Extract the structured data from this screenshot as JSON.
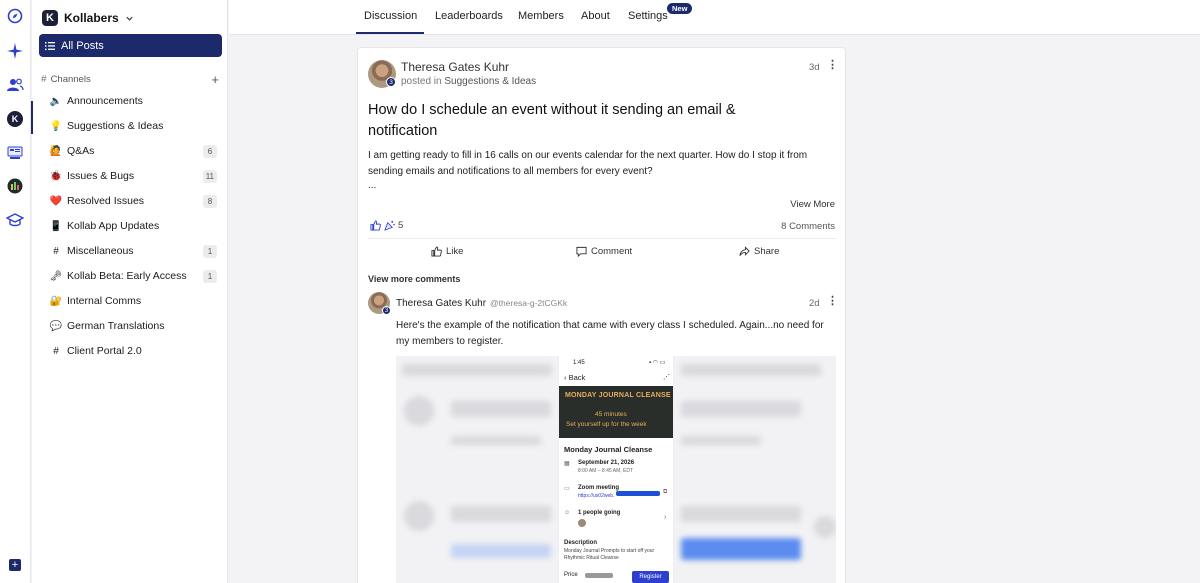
{
  "workspace": {
    "name": "Kollabers",
    "logo_letter": "K"
  },
  "sidebar": {
    "all_posts": "All Posts",
    "channels_label": "Channels",
    "channels": [
      {
        "emoji": "🔈",
        "name": "Announcements",
        "count": ""
      },
      {
        "emoji": "💡",
        "name": "Suggestions & Ideas",
        "count": ""
      },
      {
        "emoji": "🙋",
        "name": "Q&As",
        "count": "6"
      },
      {
        "emoji": "🐞",
        "name": "Issues & Bugs",
        "count": "11"
      },
      {
        "emoji": "❤️",
        "name": "Resolved Issues",
        "count": "8"
      },
      {
        "emoji": "📱",
        "name": "Kollab App Updates",
        "count": ""
      },
      {
        "emoji": "#",
        "name": "Miscellaneous",
        "count": "1"
      },
      {
        "emoji": "🗝",
        "name": "Kollab Beta: Early Access",
        "count": "1"
      },
      {
        "emoji": "🔐",
        "name": "Internal Comms",
        "count": ""
      },
      {
        "emoji": "💬",
        "name": "German Translations",
        "count": ""
      },
      {
        "emoji": "#",
        "name": "Client Portal 2.0",
        "count": ""
      }
    ]
  },
  "nav": {
    "tabs": [
      "Discussion",
      "Leaderboards",
      "Members",
      "About",
      "Settings"
    ],
    "active": "Discussion",
    "new_badge": "New"
  },
  "post": {
    "author": "Theresa Gates Kuhr",
    "posted_in_prefix": "posted in",
    "channel": "Suggestions & Ideas",
    "time": "3d",
    "level": "3",
    "title": "How do I schedule an event without it sending an email & notification",
    "body": "I am getting ready to fill in 16 calls on our events calendar for the next quarter. How do I stop it from sending emails and notifications to all members for every event?",
    "ellipsis": "...",
    "view_more": "View More",
    "reaction_count": "5",
    "comments_count": "8 Comments",
    "actions": {
      "like": "Like",
      "comment": "Comment",
      "share": "Share"
    },
    "view_more_comments": "View more comments"
  },
  "comment": {
    "author": "Theresa Gates Kuhr",
    "handle": "@theresa-g-2tCGKk",
    "time": "2d",
    "level": "3",
    "body": "Here's the example of the notification that came with every class I scheduled. Again...no need for my members to register."
  },
  "phone_shot": {
    "clock": "1:45",
    "back": "Back",
    "banner_title": "MONDAY JOURNAL CLEANSE",
    "banner_duration": "45 minutes",
    "banner_tagline": "Set yourself up for the week",
    "event_title": "Monday Journal Cleanse",
    "date": "September 21, 2026",
    "time": "8:00 AM – 8:45 AM, EDT",
    "zoom_label": "Zoom meeting",
    "zoom_link": "https://us02web.",
    "going": "1 people going",
    "description_label": "Description",
    "description": "Monday Journal Prompts to start off your Rhythmic Ritual Cleanse",
    "price_label": "Price",
    "register": "Register"
  },
  "colors": {
    "brand": "#1c2a6b",
    "accent": "#2d3fcf"
  }
}
